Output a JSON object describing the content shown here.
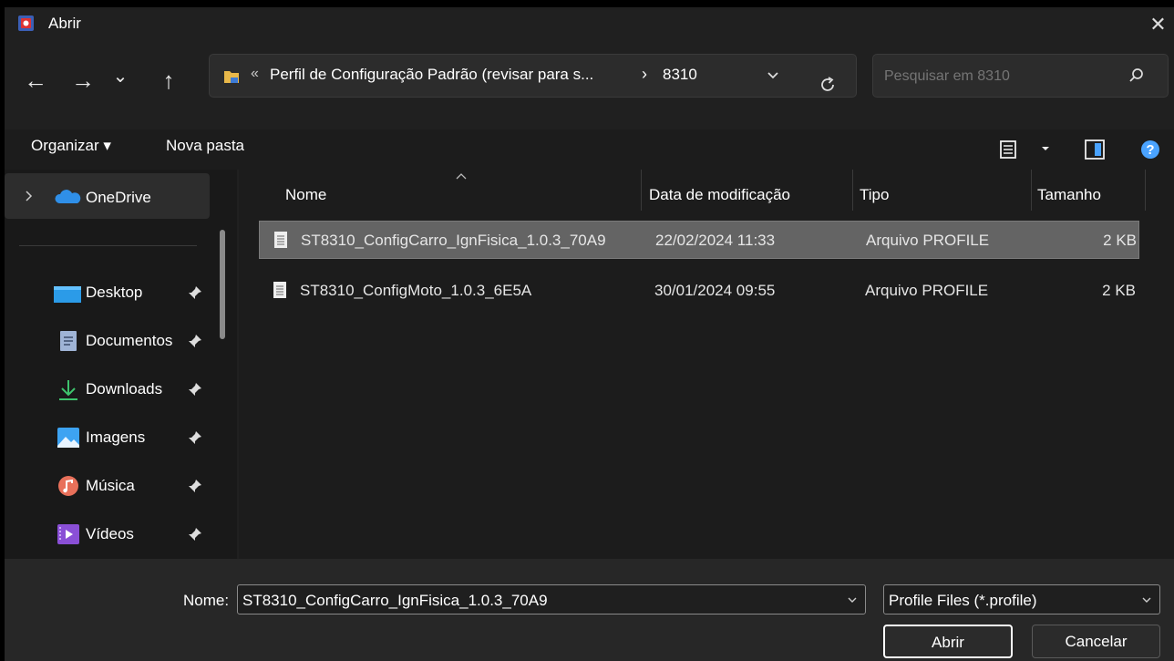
{
  "window": {
    "title": "Abrir",
    "close_glyph": "✕"
  },
  "nav": {
    "back": "←",
    "forward": "→",
    "recent": "⌄",
    "up": "↑",
    "address_prefix": "«",
    "address_path": "Perfil de Configuração Padrão (revisar para s...",
    "address_sep": "›",
    "address_current": "8310",
    "search_placeholder": "Pesquisar em 8310"
  },
  "toolbar": {
    "organize": "Organizar ▾",
    "new_folder": "Nova pasta"
  },
  "sidebar": {
    "onedrive": "OneDrive",
    "items": [
      {
        "label": "Desktop",
        "icon": "desktop-icon"
      },
      {
        "label": "Documentos",
        "icon": "documents-icon"
      },
      {
        "label": "Downloads",
        "icon": "downloads-icon"
      },
      {
        "label": "Imagens",
        "icon": "pictures-icon"
      },
      {
        "label": "Música",
        "icon": "music-icon"
      },
      {
        "label": "Vídeos",
        "icon": "videos-icon"
      }
    ]
  },
  "columns": {
    "name": "Nome",
    "modified": "Data de modificação",
    "type": "Tipo",
    "size": "Tamanho"
  },
  "files": [
    {
      "name": "ST8310_ConfigCarro_IgnFisica_1.0.3_70A9",
      "modified": "22/02/2024 11:33",
      "type": "Arquivo PROFILE",
      "size": "2 KB",
      "selected": true
    },
    {
      "name": "ST8310_ConfigMoto_1.0.3_6E5A",
      "modified": "30/01/2024 09:55",
      "type": "Arquivo PROFILE",
      "size": "2 KB",
      "selected": false
    }
  ],
  "footer": {
    "name_label": "Nome:",
    "name_value": "ST8310_ConfigCarro_IgnFisica_1.0.3_70A9",
    "filter_value": "Profile Files (*.profile)",
    "open_button": "Abrir",
    "cancel_button": "Cancelar"
  },
  "colors": {
    "selected_row": "#646464",
    "accent": "#4aa3ff",
    "background": "#202020"
  }
}
